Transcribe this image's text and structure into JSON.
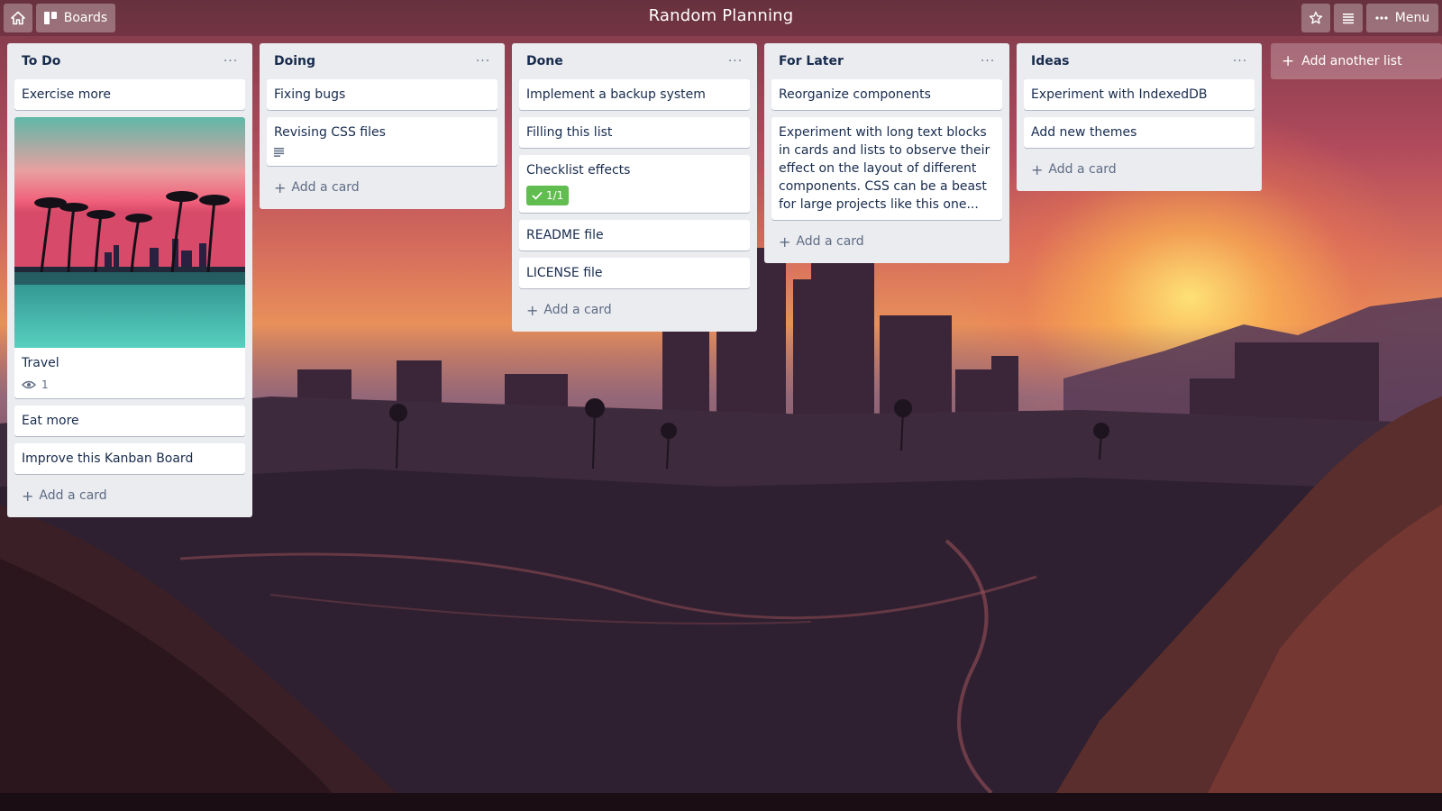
{
  "header": {
    "title": "Random Planning",
    "boards_label": "Boards",
    "menu_label": "Menu",
    "home_icon": "home-icon",
    "boards_icon": "boards-icon",
    "star_icon": "star-icon",
    "activity_icon": "activity-icon",
    "menu_icon": "ellipsis-icon"
  },
  "lists": [
    {
      "title": "To Do",
      "cards": [
        {
          "text": "Exercise more"
        },
        {
          "text": "Travel",
          "cover": "palm-sunset-image",
          "badge_icon": "eye-icon",
          "badge_count": "1"
        },
        {
          "text": "Eat more"
        },
        {
          "text": "Improve this Kanban Board"
        }
      ]
    },
    {
      "title": "Doing",
      "cards": [
        {
          "text": "Fixing bugs"
        },
        {
          "text": "Revising CSS files",
          "badge_icon": "description-icon"
        }
      ]
    },
    {
      "title": "Done",
      "cards": [
        {
          "text": "Implement a backup system"
        },
        {
          "text": "Filling this list"
        },
        {
          "text": "Checklist effects",
          "checklist": "1/1"
        },
        {
          "text": "README file"
        },
        {
          "text": "LICENSE file"
        }
      ]
    },
    {
      "title": "For Later",
      "cards": [
        {
          "text": "Reorganize components"
        },
        {
          "text": "Experiment with long text blocks in cards and lists to observe their effect on the layout of different components. CSS can be a beast for large projects like this one..."
        }
      ]
    },
    {
      "title": "Ideas",
      "cards": [
        {
          "text": "Experiment with IndexedDB"
        },
        {
          "text": "Add new themes"
        }
      ]
    }
  ],
  "add_card_label": "Add a card",
  "list_menu_symbol": "···",
  "add_list_label": "Add another list",
  "colors": {
    "list_bg": "#ebecf0",
    "card_bg": "#ffffff",
    "text": "#172b4d",
    "muted": "#5e6c84",
    "checklist_complete": "#61bd4f"
  }
}
